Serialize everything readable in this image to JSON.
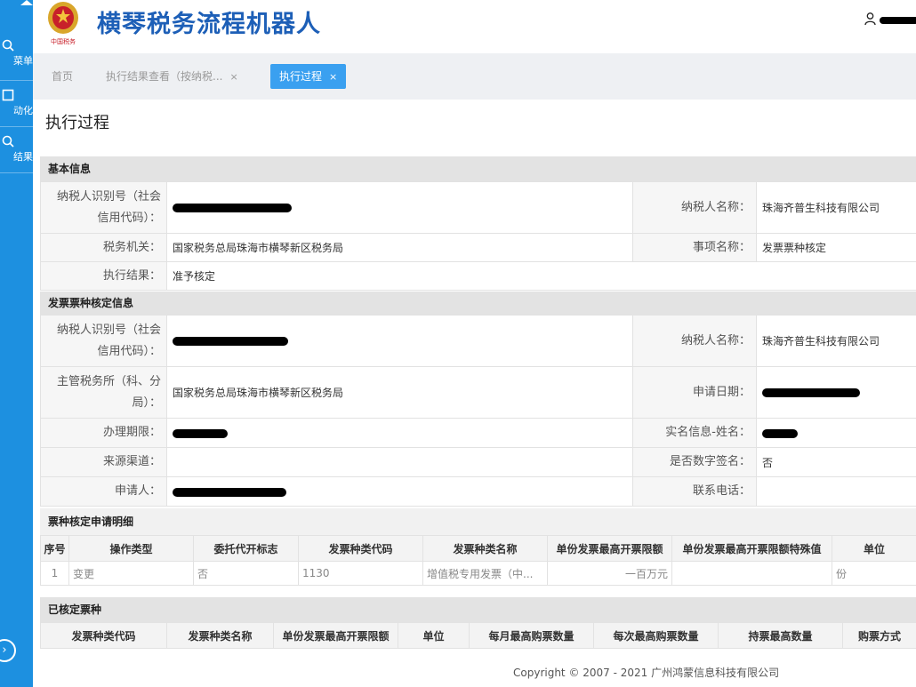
{
  "sidebar": {
    "items": [
      {
        "label": "菜单",
        "icon": "search-icon"
      },
      {
        "label": "动化",
        "icon": "square-icon"
      },
      {
        "label": "结果",
        "icon": "search-icon"
      }
    ],
    "collapse_icon": "chevron-right-icon"
  },
  "header": {
    "emblem_text": "中国税务",
    "title": "横琴税务流程机器人",
    "user_icon": "user-icon"
  },
  "tabs": [
    {
      "label": "首页",
      "closable": false,
      "active": false
    },
    {
      "label": "执行结果查看（按纳税...",
      "closable": true,
      "active": false
    },
    {
      "label": "执行过程",
      "closable": true,
      "active": true
    }
  ],
  "tab_close_glyph": "×",
  "page_title": "执行过程",
  "basic_info": {
    "section_title": "基本信息",
    "taxpayer_id_label": "纳税人识别号（社会信用代码）：",
    "taxpayer_name_label": "纳税人名称：",
    "taxpayer_name": "珠海齐普生科技有限公司",
    "tax_authority_label": "税务机关：",
    "tax_authority": "国家税务总局珠海市横琴新区税务局",
    "item_name_label": "事项名称：",
    "item_name": "发票票种核定",
    "result_label": "执行结果：",
    "result": "准予核定"
  },
  "invoice_info": {
    "section_title": "发票票种核定信息",
    "taxpayer_id_label": "纳税人识别号（社会信用代码）：",
    "taxpayer_name_label": "纳税人名称：",
    "taxpayer_name": "珠海齐普生科技有限公司",
    "office_label": "主管税务所（科、分局）：",
    "office": "国家税务总局珠海市横琴新区税务局",
    "apply_date_label": "申请日期：",
    "deadline_label": "办理期限：",
    "realname_label": "实名信息-姓名：",
    "channel_label": "来源渠道：",
    "digital_sign_label": "是否数字签名：",
    "digital_sign": "否",
    "applicant_label": "申请人：",
    "phone_label": "联系电话："
  },
  "apply_detail": {
    "section_title": "票种核定申请明细",
    "headers": [
      "序号",
      "操作类型",
      "委托代开标志",
      "发票种类代码",
      "发票种类名称",
      "单份发票最高开票限额",
      "单份发票最高开票限额特殊值",
      "单位"
    ],
    "rows": [
      [
        "1",
        "变更",
        "否",
        "1130",
        "增值税专用发票（中...",
        "一百万元",
        "",
        "份"
      ]
    ]
  },
  "approved": {
    "section_title": "已核定票种",
    "headers": [
      "发票种类代码",
      "发票种类名称",
      "单份发票最高开票限额",
      "单位",
      "每月最高购票数量",
      "每次最高购票数量",
      "持票最高数量",
      "购票方式"
    ]
  },
  "footer": "Copyright © 2007 - 2021 广州鸿蒙信息科技有限公司"
}
